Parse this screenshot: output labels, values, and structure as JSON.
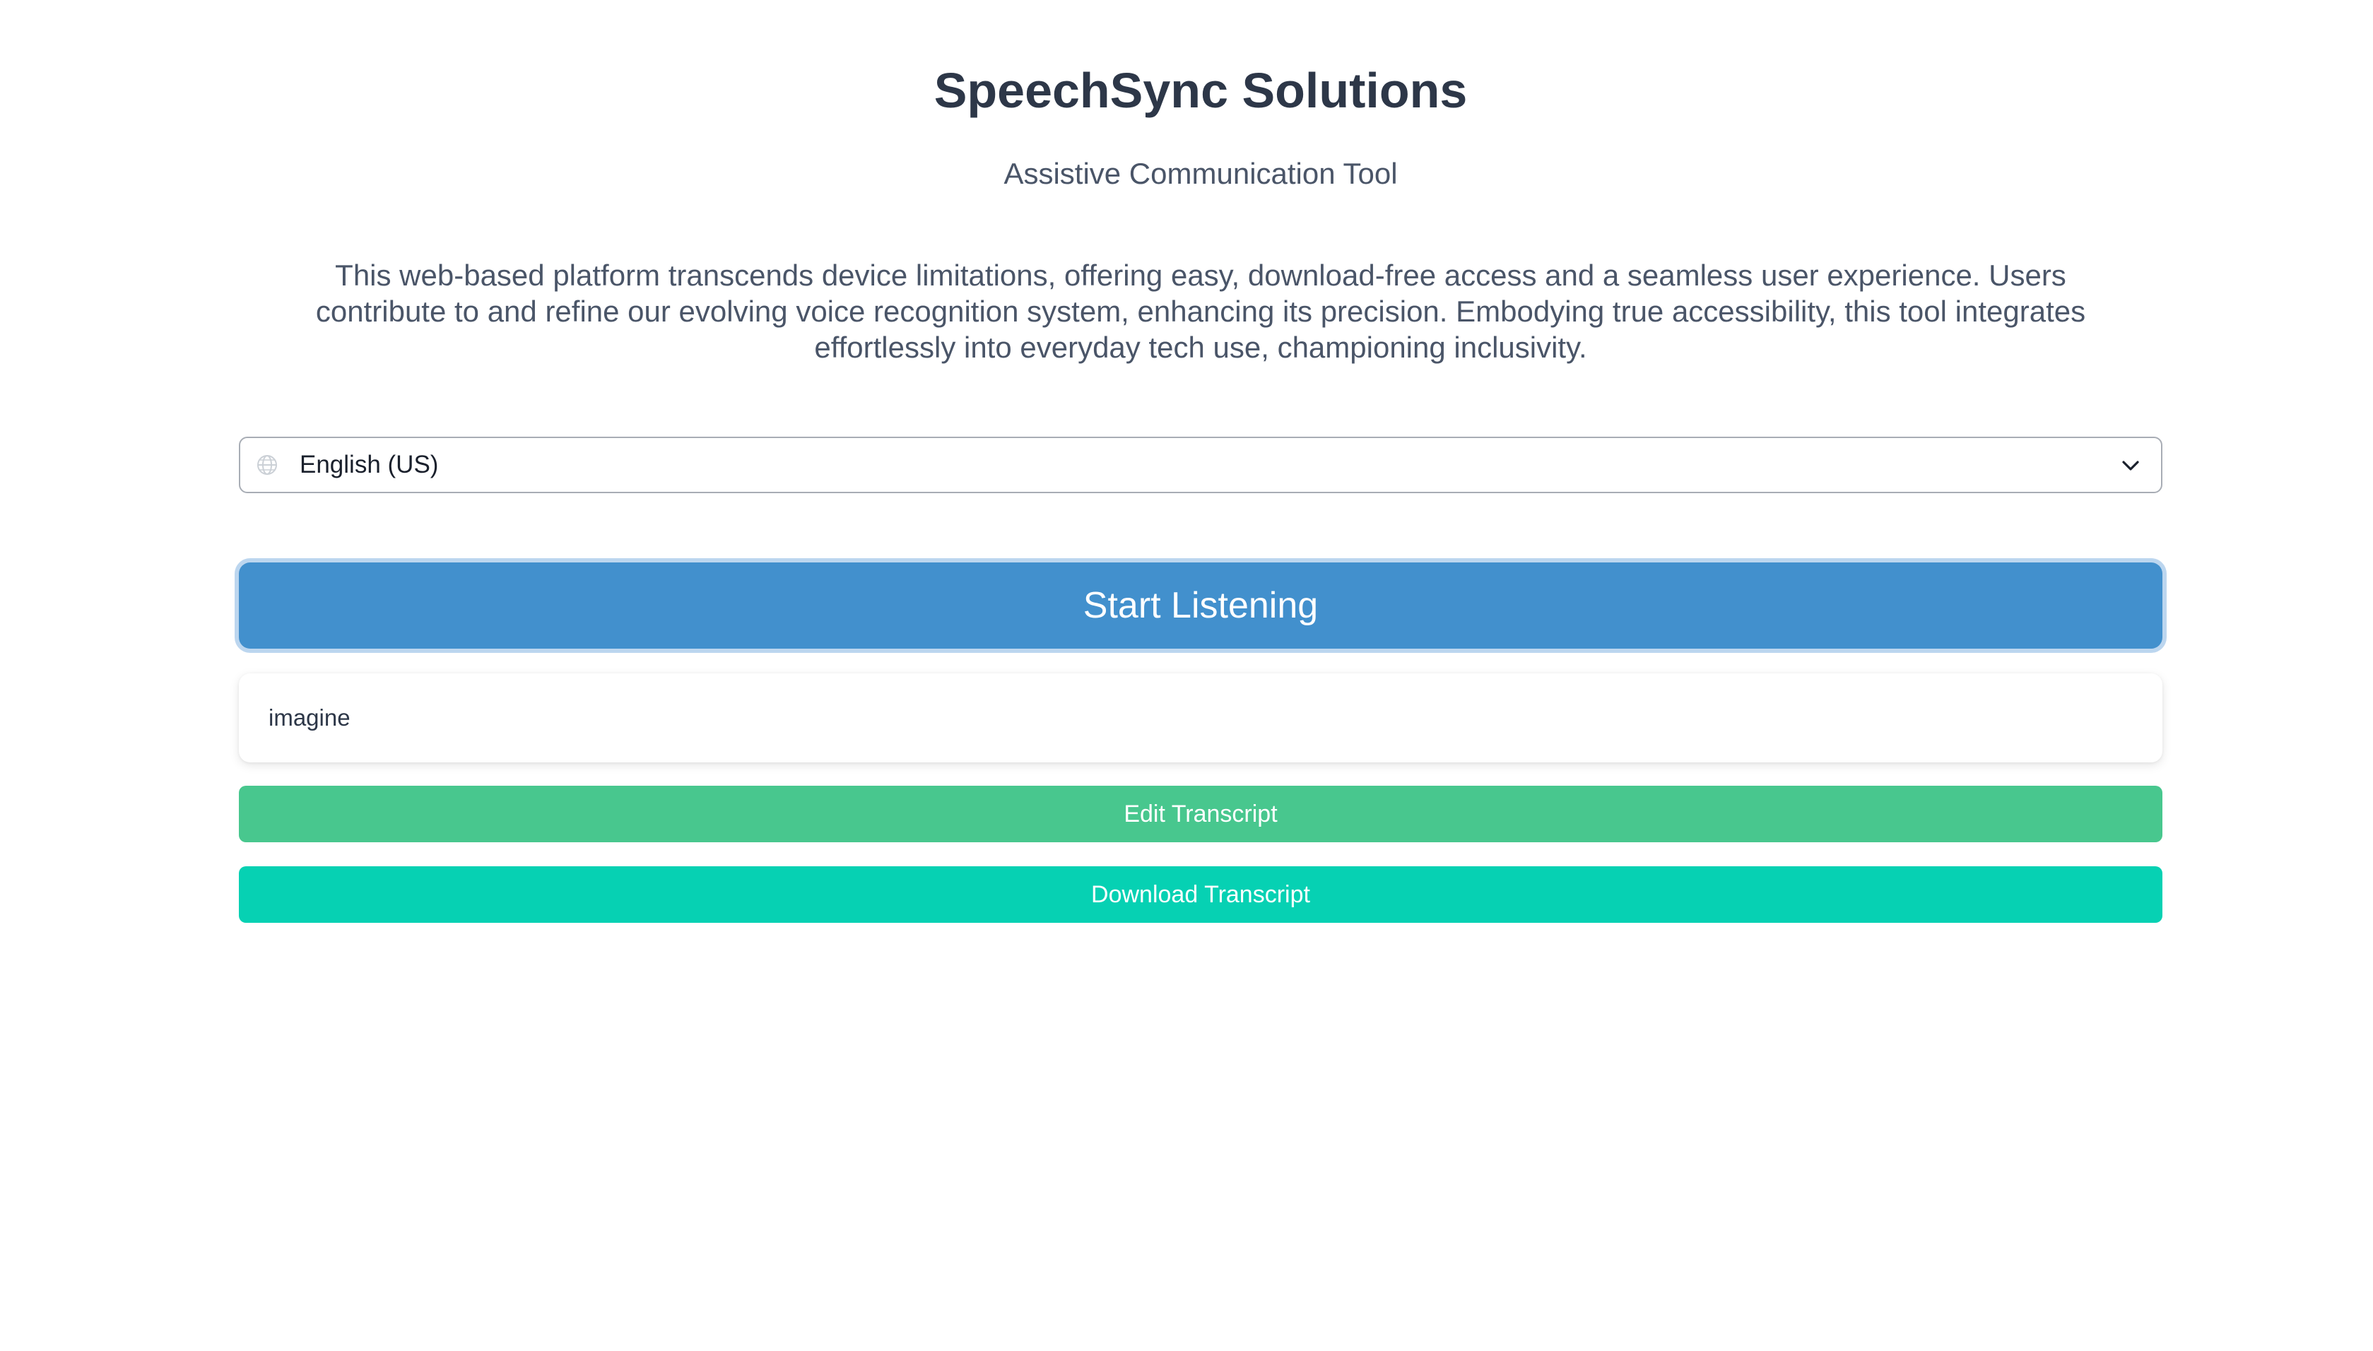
{
  "header": {
    "title": "SpeechSync Solutions",
    "subtitle": "Assistive Communication Tool"
  },
  "intro": {
    "description": "This web-based platform transcends device limitations, offering easy, download-free access and a seamless user experience. Users contribute to and refine our evolving voice recognition system, enhancing its precision. Embodying true accessibility, this tool integrates effortlessly into everyday tech use, championing inclusivity."
  },
  "language_select": {
    "selected": "English (US)",
    "icon": "globe-icon",
    "dropdown_icon": "chevron-down-icon"
  },
  "actions": {
    "start_label": "Start Listening",
    "edit_label": "Edit Transcript",
    "download_label": "Download Transcript"
  },
  "transcript": {
    "text": "imagine"
  },
  "colors": {
    "start_button": "#4290cd",
    "edit_button": "#48c78e",
    "download_button": "#06d1b3",
    "title_text": "#2d3748"
  }
}
